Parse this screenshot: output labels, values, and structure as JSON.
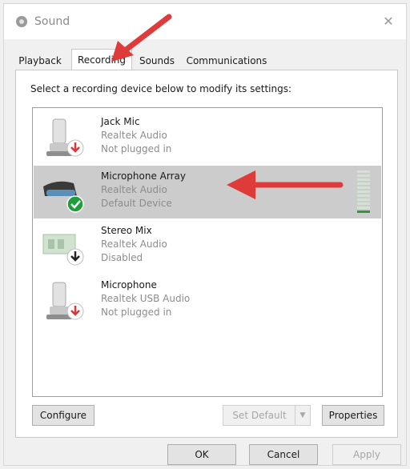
{
  "window": {
    "title": "Sound"
  },
  "tabs": [
    {
      "label": "Playback"
    },
    {
      "label": "Recording"
    },
    {
      "label": "Sounds"
    },
    {
      "label": "Communications"
    }
  ],
  "instruction": "Select a recording device below to modify its settings:",
  "devices": [
    {
      "name": "Jack Mic",
      "driver": "Realtek Audio",
      "status": "Not plugged in",
      "icon": "microphone-icon",
      "badge": "unplugged-badge-icon"
    },
    {
      "name": "Microphone Array",
      "driver": "Realtek Audio",
      "status": "Default Device",
      "icon": "microphone-array-icon",
      "badge": "default-device-check-icon",
      "level": 0.1
    },
    {
      "name": "Stereo Mix",
      "driver": "Realtek Audio",
      "status": "Disabled",
      "icon": "sound-card-icon",
      "badge": "disabled-badge-icon"
    },
    {
      "name": "Microphone",
      "driver": "Realtek USB Audio",
      "status": "Not plugged in",
      "icon": "microphone-icon",
      "badge": "unplugged-badge-icon"
    }
  ],
  "buttons": {
    "configure": "Configure",
    "set_default": "Set Default",
    "properties": "Properties",
    "ok": "OK",
    "cancel": "Cancel",
    "apply": "Apply"
  },
  "colors": {
    "annotation_arrow": "#e03b3b",
    "selected_row": "#cccccc",
    "level_meter": "#2a9a3a",
    "default_badge": "#1f9d3a",
    "unplugged_badge": "#d9363e"
  }
}
